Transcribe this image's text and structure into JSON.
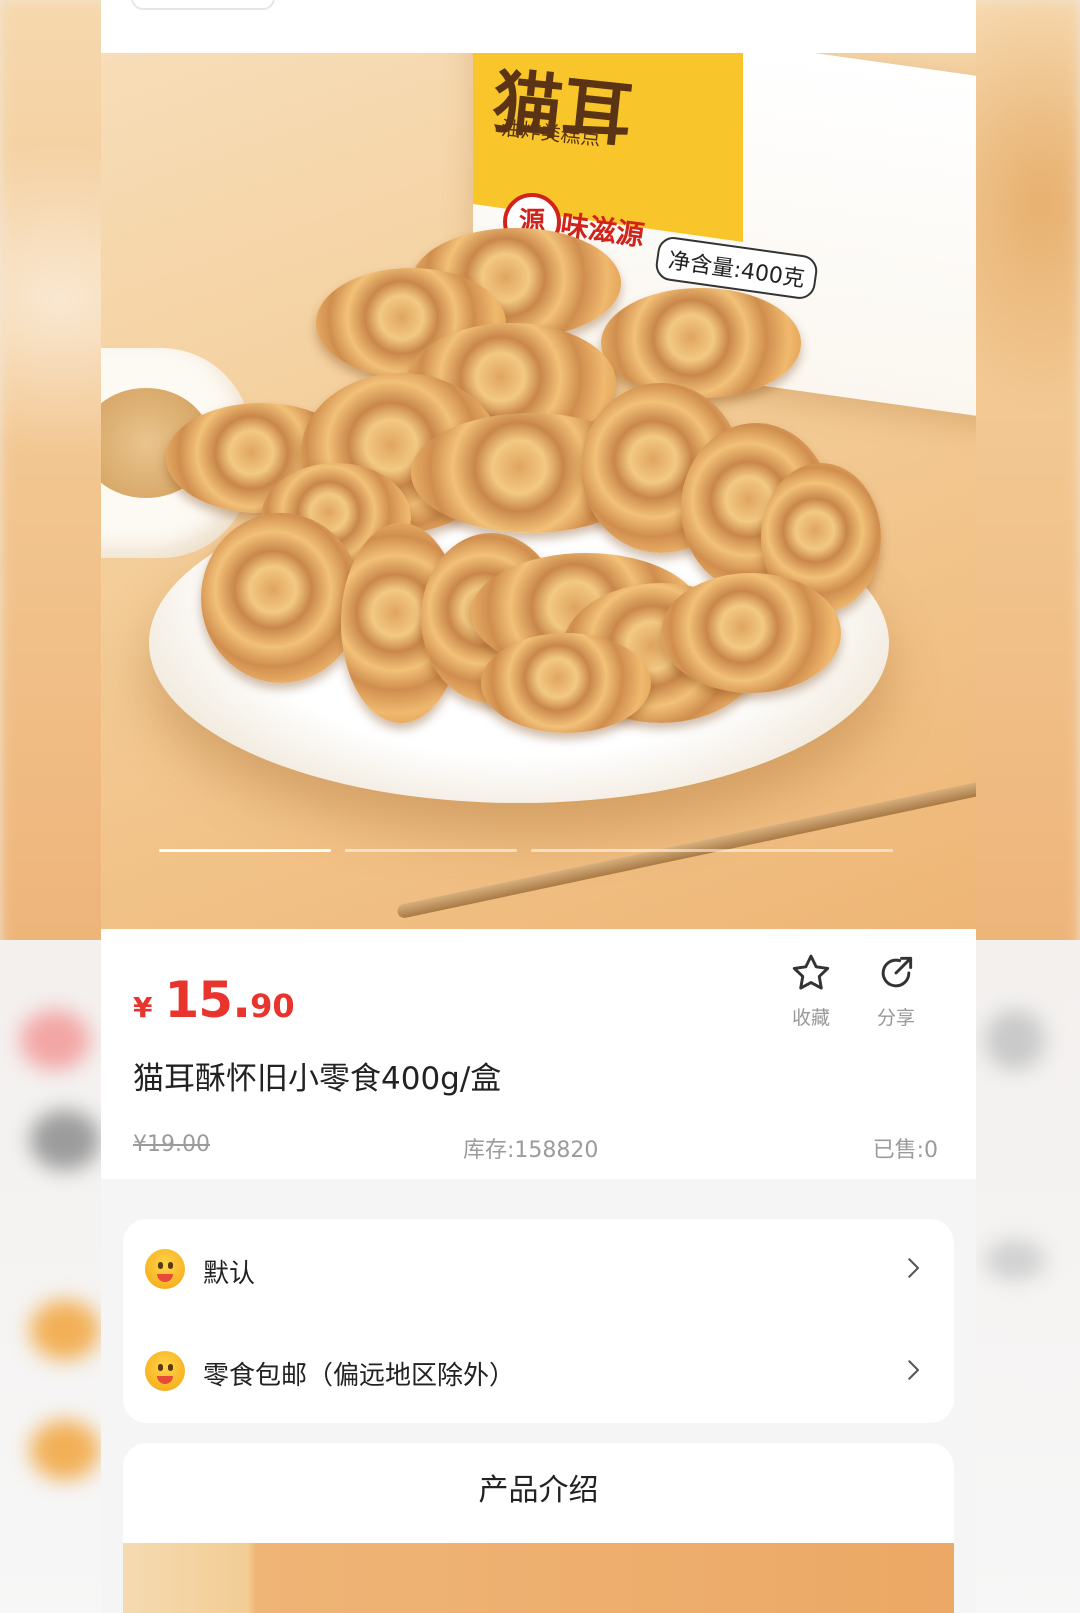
{
  "product": {
    "price_currency": "¥",
    "price_int": "15.",
    "price_dec": "90",
    "title": "猫耳酥怀旧小零食400g/盒",
    "original_price": "¥19.00",
    "stock": "库存:158820",
    "sold": "已售:0"
  },
  "hero_image": {
    "brand_text": "味滋源",
    "brand_mark": "源",
    "pack_title": "猫耳",
    "pack_sub": "油炸类糕点",
    "net_weight": "净含量:400克",
    "carousel": {
      "count": 3,
      "active_index": 0
    }
  },
  "actions": {
    "favorite_label": "收藏",
    "share_label": "分享"
  },
  "options": [
    {
      "label": "默认"
    },
    {
      "label": "零食包邮（偏远地区除外）"
    }
  ],
  "intro": {
    "heading": "产品介绍"
  },
  "colors": {
    "price": "#e8342c",
    "muted": "#9b9b9b",
    "text": "#222222"
  }
}
